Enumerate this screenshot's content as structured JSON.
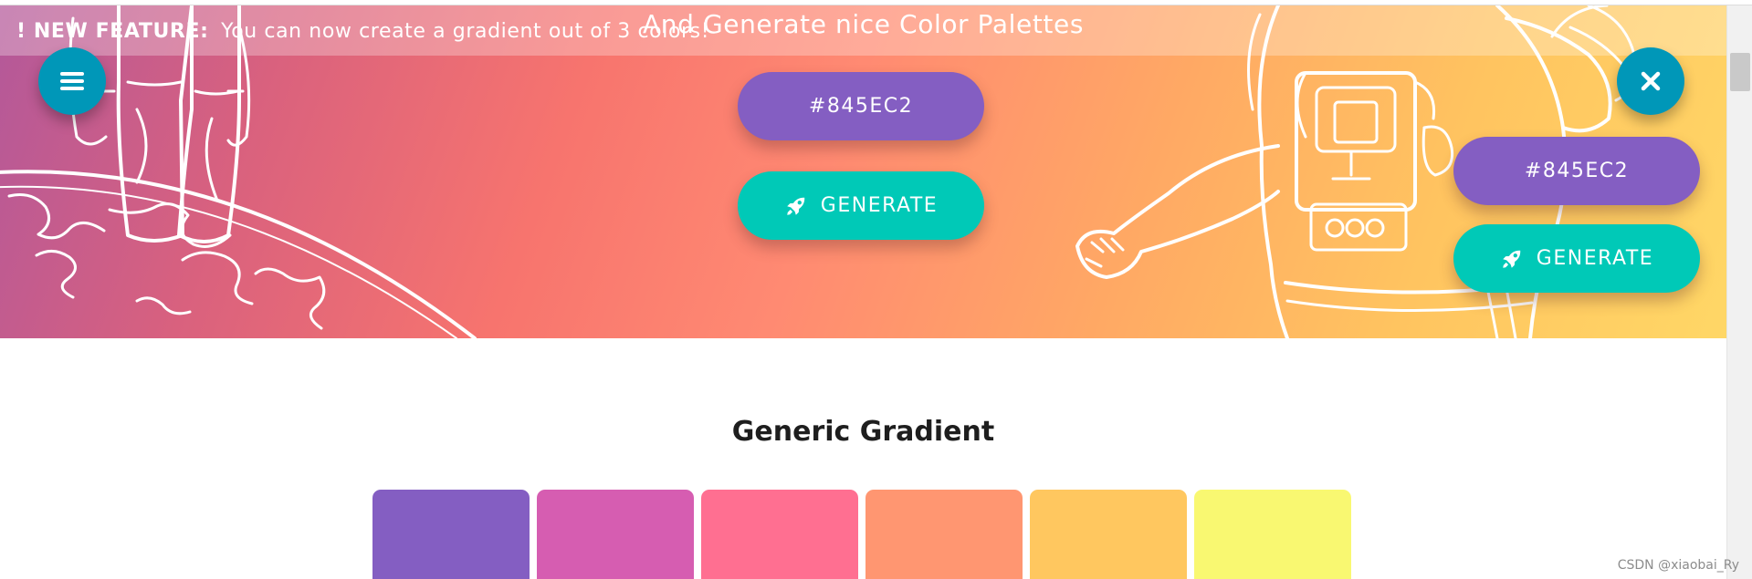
{
  "announcement": {
    "strong": "! NEW FEATURE:",
    "text": "You can now create a gradient out of 3 colors!"
  },
  "hero": {
    "tagline": "And Generate nice Color Palettes",
    "primary": {
      "hex_label": "#845EC2",
      "generate_label": "GENERATE"
    },
    "secondary": {
      "hex_label": "#845EC2",
      "generate_label": "GENERATE"
    }
  },
  "icons": {
    "menu": "menu-icon",
    "close": "close-icon",
    "rocket": "rocket-icon"
  },
  "section": {
    "title": "Generic Gradient",
    "swatches": [
      "#845EC2",
      "#D65DB1",
      "#FF6F91",
      "#FF9671",
      "#FFC75F",
      "#F9F871"
    ]
  },
  "colors": {
    "hex_button": "#845EC2",
    "generate_button": "#00C9B7",
    "round_button": "#0097B8"
  },
  "watermark": "CSDN @xiaobai_Ry"
}
